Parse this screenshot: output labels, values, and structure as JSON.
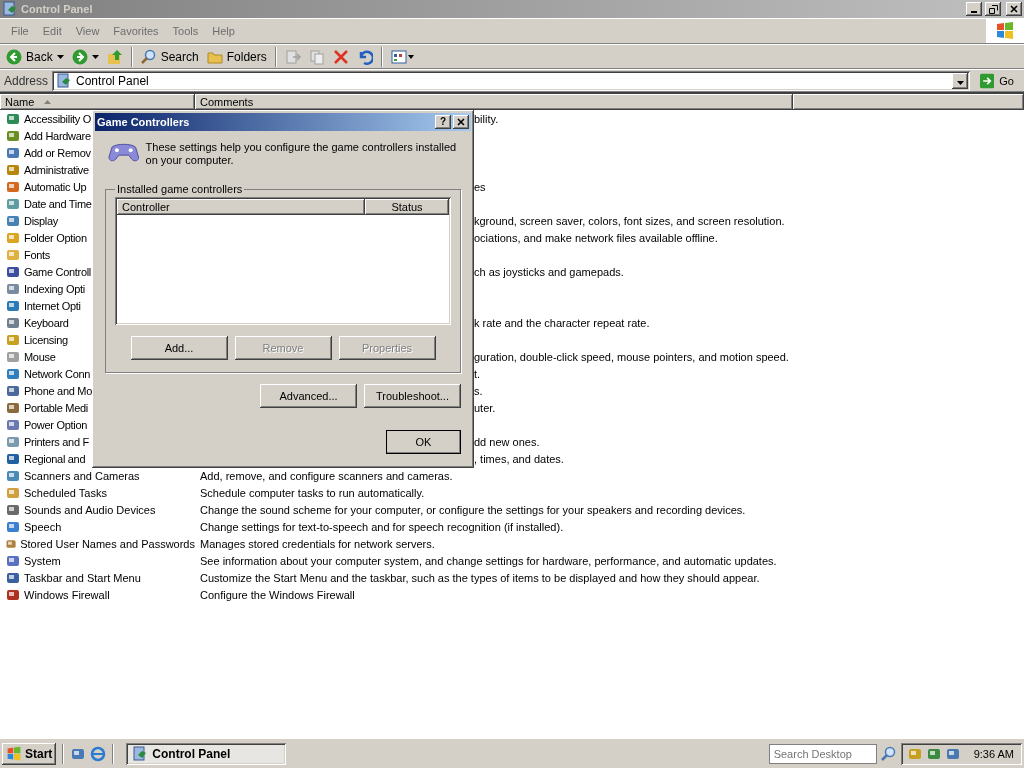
{
  "window": {
    "title": "Control Panel"
  },
  "menu": [
    "File",
    "Edit",
    "View",
    "Favorites",
    "Tools",
    "Help"
  ],
  "toolbar": [
    {
      "kind": "back",
      "label": "Back"
    },
    {
      "kind": "forward"
    },
    {
      "kind": "up"
    },
    {
      "kind": "search",
      "label": "Search"
    },
    {
      "kind": "folders",
      "label": "Folders"
    },
    {
      "kind": "move"
    },
    {
      "kind": "copy"
    },
    {
      "kind": "delete"
    },
    {
      "kind": "undo"
    },
    {
      "kind": "views"
    }
  ],
  "address": {
    "label": "Address",
    "value": "Control Panel",
    "go": "Go"
  },
  "table": {
    "columns": [
      "Name",
      "Comments"
    ],
    "rows": [
      {
        "name": "Accessibility O",
        "comment": "bility.",
        "covered": true
      },
      {
        "name": "Add Hardware",
        "comment": "",
        "covered": true
      },
      {
        "name": "Add or Remov",
        "comment": "",
        "covered": true
      },
      {
        "name": "Administrative",
        "comment": "",
        "covered": true
      },
      {
        "name": "Automatic Up",
        "comment": "es",
        "covered": true
      },
      {
        "name": "Date and Time",
        "comment": "",
        "covered": true
      },
      {
        "name": "Display",
        "comment": "kground, screen saver, colors, font sizes, and screen resolution.",
        "covered": true
      },
      {
        "name": "Folder Option",
        "comment": "ociations, and make network files available offline.",
        "covered": true
      },
      {
        "name": "Fonts",
        "comment": "",
        "covered": true
      },
      {
        "name": "Game Controll",
        "comment": "ch as joysticks and gamepads.",
        "covered": true
      },
      {
        "name": "Indexing Opti",
        "comment": "",
        "covered": true
      },
      {
        "name": "Internet Opti",
        "comment": "",
        "covered": true
      },
      {
        "name": "Keyboard",
        "comment": "k rate and the character repeat rate.",
        "covered": true
      },
      {
        "name": "Licensing",
        "comment": "",
        "covered": true
      },
      {
        "name": "Mouse",
        "comment": "guration, double-click speed, mouse pointers, and motion speed.",
        "covered": true
      },
      {
        "name": "Network Conn",
        "comment": "t.",
        "covered": true
      },
      {
        "name": "Phone and Mo",
        "comment": "s.",
        "covered": true
      },
      {
        "name": "Portable Medi",
        "comment": "uter.",
        "covered": true
      },
      {
        "name": "Power Option",
        "comment": "",
        "covered": true
      },
      {
        "name": "Printers and F",
        "comment": "dd new ones.",
        "covered": true
      },
      {
        "name": "Regional and",
        "comment": ", times, and dates.",
        "covered": true
      },
      {
        "name": "Scanners and Cameras",
        "comment": "Add, remove, and configure scanners and cameras.",
        "covered": false
      },
      {
        "name": "Scheduled Tasks",
        "comment": "Schedule computer tasks to run automatically.",
        "covered": false
      },
      {
        "name": "Sounds and Audio Devices",
        "comment": "Change the sound scheme for your computer, or configure the settings for your speakers and recording devices.",
        "covered": false
      },
      {
        "name": "Speech",
        "comment": "Change settings for text-to-speech and for speech recognition (if installed).",
        "covered": false
      },
      {
        "name": "Stored User Names and Passwords",
        "comment": "Manages stored credentials for network servers.",
        "covered": false
      },
      {
        "name": "System",
        "comment": "See information about your computer system, and change settings for hardware, performance, and automatic updates.",
        "covered": false
      },
      {
        "name": "Taskbar and Start Menu",
        "comment": "Customize the Start Menu and the taskbar, such as the types of items to be displayed and how they should appear.",
        "covered": false
      },
      {
        "name": "Windows Firewall",
        "comment": "Configure the Windows Firewall",
        "covered": false
      }
    ]
  },
  "dialog": {
    "title": "Game Controllers",
    "help": "?",
    "intro": "These settings help you configure the game controllers installed on your computer.",
    "group": "Installed game controllers",
    "columns": [
      "Controller",
      "Status"
    ],
    "list_buttons": [
      {
        "label": "Add...",
        "disabled": false
      },
      {
        "label": "Remove",
        "disabled": true
      },
      {
        "label": "Properties",
        "disabled": true
      }
    ],
    "buttons": [
      {
        "label": "Advanced...",
        "disabled": false
      },
      {
        "label": "Troubleshoot...",
        "disabled": false
      }
    ],
    "ok": "OK"
  },
  "taskbar": {
    "start": "Start",
    "tasks": [
      {
        "label": "Control Panel",
        "selected": true
      }
    ],
    "search": {
      "placeholder": "Search Desktop"
    },
    "clock": "9:36 AM"
  }
}
